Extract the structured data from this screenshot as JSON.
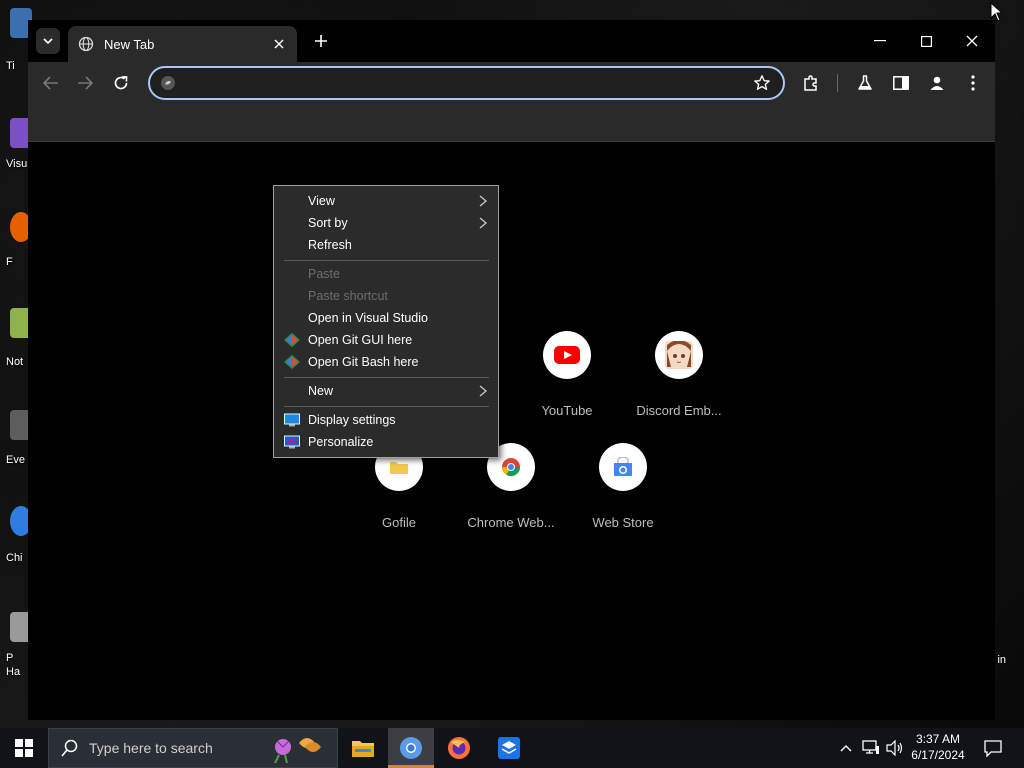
{
  "desktop": {
    "icon_labels": [
      "Ti",
      "Visu",
      "F",
      "Not",
      "Eve",
      "Chi",
      "P",
      "Ha"
    ],
    "right_label": "in"
  },
  "browser": {
    "tab": {
      "title": "New Tab"
    },
    "omnibox": {
      "value": "",
      "placeholder": ""
    },
    "icons": {
      "tab_search": "chevron-down-icon",
      "tab_favicon": "globe-icon",
      "tab_close": "close-icon",
      "new_tab": "plus-icon",
      "minimize": "minimize-icon",
      "maximize": "maximize-icon",
      "close": "close-icon",
      "back": "back-arrow-icon",
      "forward": "forward-arrow-icon",
      "reload": "reload-icon",
      "bookmark": "star-icon",
      "extensions": "puzzle-icon",
      "labs": "flask-icon",
      "side_panel": "side-panel-icon",
      "profile": "person-icon",
      "menu": "kebab-menu-icon"
    },
    "shortcuts": [
      {
        "name": "YouTube",
        "icon": "youtube-icon"
      },
      {
        "name": "Discord Emb...",
        "icon": "anime-avatar-icon"
      },
      {
        "name": "Gofile",
        "icon": "folder-icon"
      },
      {
        "name": "Chrome Web...",
        "icon": "chrome-icon"
      },
      {
        "name": "Web Store",
        "icon": "web-store-icon"
      }
    ]
  },
  "context_menu": {
    "items": [
      {
        "label": "View",
        "submenu": true,
        "disabled": false
      },
      {
        "label": "Sort by",
        "submenu": true,
        "disabled": false
      },
      {
        "label": "Refresh",
        "submenu": false,
        "disabled": false
      },
      {
        "label": "Paste",
        "submenu": false,
        "disabled": true
      },
      {
        "label": "Paste shortcut",
        "submenu": false,
        "disabled": true
      },
      {
        "label": "Open in Visual Studio",
        "submenu": false,
        "disabled": false
      },
      {
        "label": "Open Git GUI here",
        "submenu": false,
        "disabled": false,
        "icon": "git-icon"
      },
      {
        "label": "Open Git Bash here",
        "submenu": false,
        "disabled": false,
        "icon": "git-icon"
      },
      {
        "label": "New",
        "submenu": true,
        "disabled": false
      },
      {
        "label": "Display settings",
        "submenu": false,
        "disabled": false,
        "icon": "monitor-icon"
      },
      {
        "label": "Personalize",
        "submenu": false,
        "disabled": false,
        "icon": "personalize-icon"
      }
    ]
  },
  "taskbar": {
    "search_placeholder": "Type here to search",
    "apps": [
      "file-explorer-icon",
      "chrome-icon",
      "firefox-icon",
      "store-icon"
    ],
    "active_app": "chrome-icon",
    "clock": {
      "time": "3:37 AM",
      "date": "6/17/2024"
    }
  },
  "colors": {
    "accent_focus": "#a8c7fa",
    "toolbar_bg": "#2a2a2a",
    "taskbar_bg": "#101418",
    "youtube_red": "#ff0000",
    "active_underline": "#c98a3c"
  }
}
